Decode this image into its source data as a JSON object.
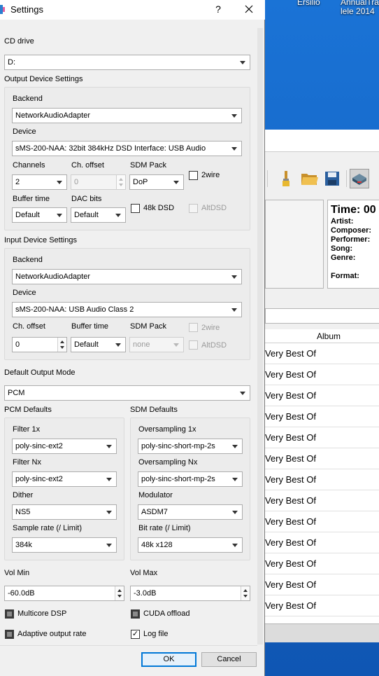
{
  "desktop": {
    "icon_labels": [
      "Ersilio",
      "AnnualTra\nlele 2014"
    ]
  },
  "background_app": {
    "info": {
      "time": "Time: 00",
      "artist": "Artist:",
      "composer": "Composer:",
      "performer": "Performer:",
      "song": "Song:",
      "genre": "Genre:",
      "format": "Format:"
    },
    "list": {
      "header_album": "Album",
      "rows": [
        "Very Best Of",
        "Very Best Of",
        "Very Best Of",
        "Very Best Of",
        "Very Best Of",
        "Very Best Of",
        "Very Best Of",
        "Very Best Of",
        "Very Best Of",
        "Very Best Of",
        "Very Best Of",
        "Very Best Of",
        "Very Best Of"
      ]
    }
  },
  "dialog": {
    "title": "Settings",
    "help_label": "?",
    "cd_drive": {
      "label": "CD drive",
      "value": "D:"
    },
    "output": {
      "section_label": "Output Device Settings",
      "backend_label": "Backend",
      "backend_value": "NetworkAudioAdapter",
      "device_label": "Device",
      "device_value": "sMS-200-NAA: 32bit 384kHz DSD Interface: USB Audio",
      "channels_label": "Channels",
      "channels_value": "2",
      "ch_offset_label": "Ch. offset",
      "ch_offset_value": "0",
      "sdm_pack_label": "SDM Pack",
      "sdm_pack_value": "DoP",
      "twowire_label": "2wire",
      "buffer_time_label": "Buffer time",
      "buffer_time_value": "Default",
      "dac_bits_label": "DAC bits",
      "dac_bits_value": "Default",
      "k48dsd_label": "48k DSD",
      "altdsd_label": "AltDSD"
    },
    "input": {
      "section_label": "Input Device Settings",
      "backend_label": "Backend",
      "backend_value": "NetworkAudioAdapter",
      "device_label": "Device",
      "device_value": "sMS-200-NAA: USB Audio Class 2",
      "ch_offset_label": "Ch. offset",
      "ch_offset_value": "0",
      "buffer_time_label": "Buffer time",
      "buffer_time_value": "Default",
      "sdm_pack_label": "SDM Pack",
      "sdm_pack_value": "none",
      "twowire_label": "2wire",
      "altdsd_label": "AltDSD"
    },
    "default_output_mode": {
      "label": "Default Output Mode",
      "value": "PCM"
    },
    "pcm_defaults": {
      "section_label": "PCM Defaults",
      "filter1x_label": "Filter 1x",
      "filter1x_value": "poly-sinc-ext2",
      "filternx_label": "Filter Nx",
      "filternx_value": "poly-sinc-ext2",
      "dither_label": "Dither",
      "dither_value": "NS5",
      "samplerate_label": "Sample rate (/ Limit)",
      "samplerate_value": "384k"
    },
    "sdm_defaults": {
      "section_label": "SDM Defaults",
      "os1x_label": "Oversampling 1x",
      "os1x_value": "poly-sinc-short-mp-2s",
      "osnx_label": "Oversampling Nx",
      "osnx_value": "poly-sinc-short-mp-2s",
      "modulator_label": "Modulator",
      "modulator_value": "ASDM7",
      "bitrate_label": "Bit rate (/ Limit)",
      "bitrate_value": "48k x128"
    },
    "vol_min": {
      "label": "Vol Min",
      "value": "-60.0dB"
    },
    "vol_max": {
      "label": "Vol Max",
      "value": "-3.0dB"
    },
    "multicore_dsp": {
      "label": "Multicore DSP",
      "checked": false
    },
    "cuda_offload": {
      "label": "CUDA offload",
      "checked": false
    },
    "adaptive_output_rate": {
      "label": "Adaptive output rate",
      "checked": false
    },
    "log_file": {
      "label": "Log file",
      "checked": true,
      "mark": "✓"
    },
    "ok_label": "OK",
    "cancel_label": "Cancel"
  },
  "colors": {
    "desktop": "#1667c7",
    "dialog_bg": "#f0f0f0",
    "accent": "#0078d7"
  }
}
